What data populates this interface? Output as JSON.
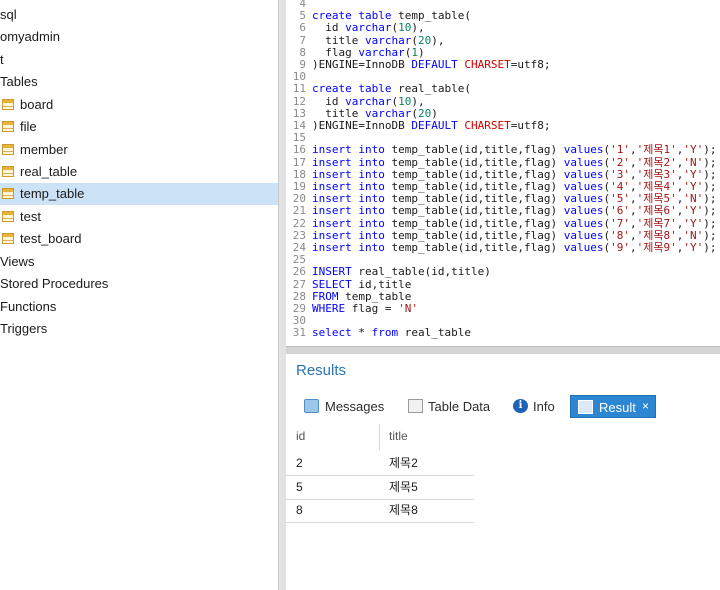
{
  "sidebar": {
    "items": [
      {
        "label": "sql",
        "icon": null
      },
      {
        "label": "omyadmin",
        "icon": null
      },
      {
        "label": "t",
        "icon": null
      },
      {
        "label": "Tables",
        "icon": null
      },
      {
        "label": "board",
        "icon": "table-icon"
      },
      {
        "label": "file",
        "icon": "table-icon"
      },
      {
        "label": "member",
        "icon": "table-icon"
      },
      {
        "label": "real_table",
        "icon": "table-icon"
      },
      {
        "label": "temp_table",
        "icon": "table-icon",
        "selected": true
      },
      {
        "label": "test",
        "icon": "table-icon"
      },
      {
        "label": "test_board",
        "icon": "table-icon"
      },
      {
        "label": "Views",
        "icon": null
      },
      {
        "label": "Stored Procedures",
        "icon": null
      },
      {
        "label": "Functions",
        "icon": null
      },
      {
        "label": "Triggers",
        "icon": null
      }
    ]
  },
  "editor": {
    "lines": [
      {
        "n": "4",
        "text": ""
      },
      {
        "n": "5",
        "text": "create table temp_table("
      },
      {
        "n": "6",
        "text": "  id varchar(10),"
      },
      {
        "n": "7",
        "text": "  title varchar(20),"
      },
      {
        "n": "8",
        "text": "  flag varchar(1)"
      },
      {
        "n": "9",
        "text": ")ENGINE=InnoDB DEFAULT CHARSET=utf8;"
      },
      {
        "n": "10",
        "text": ""
      },
      {
        "n": "11",
        "text": "create table real_table("
      },
      {
        "n": "12",
        "text": "  id varchar(10),"
      },
      {
        "n": "13",
        "text": "  title varchar(20)"
      },
      {
        "n": "14",
        "text": ")ENGINE=InnoDB DEFAULT CHARSET=utf8;"
      },
      {
        "n": "15",
        "text": ""
      },
      {
        "n": "16",
        "text": "insert into temp_table(id,title,flag) values('1','제목1','Y');"
      },
      {
        "n": "17",
        "text": "insert into temp_table(id,title,flag) values('2','제목2','N');"
      },
      {
        "n": "18",
        "text": "insert into temp_table(id,title,flag) values('3','제목3','Y');"
      },
      {
        "n": "19",
        "text": "insert into temp_table(id,title,flag) values('4','제목4','Y');"
      },
      {
        "n": "20",
        "text": "insert into temp_table(id,title,flag) values('5','제목5','N');"
      },
      {
        "n": "21",
        "text": "insert into temp_table(id,title,flag) values('6','제목6','Y');"
      },
      {
        "n": "22",
        "text": "insert into temp_table(id,title,flag) values('7','제목7','Y');"
      },
      {
        "n": "23",
        "text": "insert into temp_table(id,title,flag) values('8','제목8','N');"
      },
      {
        "n": "24",
        "text": "insert into temp_table(id,title,flag) values('9','제목9','Y');"
      },
      {
        "n": "25",
        "text": ""
      },
      {
        "n": "26",
        "text": "INSERT real_table(id,title)"
      },
      {
        "n": "27",
        "text": "SELECT id,title"
      },
      {
        "n": "28",
        "text": "FROM temp_table"
      },
      {
        "n": "29",
        "text": "WHERE flag = 'N'"
      },
      {
        "n": "30",
        "text": ""
      },
      {
        "n": "31",
        "text": "select * from real_table"
      }
    ]
  },
  "results": {
    "title": "Results",
    "tabs": [
      {
        "label": "Messages",
        "icon": "messages-icon"
      },
      {
        "label": "Table Data",
        "icon": "table-data-icon"
      },
      {
        "label": "Info",
        "icon": "info-icon"
      },
      {
        "label": "Result",
        "icon": "result-icon",
        "active": true,
        "close": "×"
      }
    ],
    "columns": [
      "id",
      "title"
    ],
    "rows": [
      [
        "2",
        "제목2"
      ],
      [
        "5",
        "제목5"
      ],
      [
        "8",
        "제목8"
      ]
    ]
  },
  "colors": {
    "selection": "#cce2f6",
    "accent": "#2d86d1",
    "keyword": "#0000ff",
    "string": "#a31515",
    "number": "#098658"
  }
}
